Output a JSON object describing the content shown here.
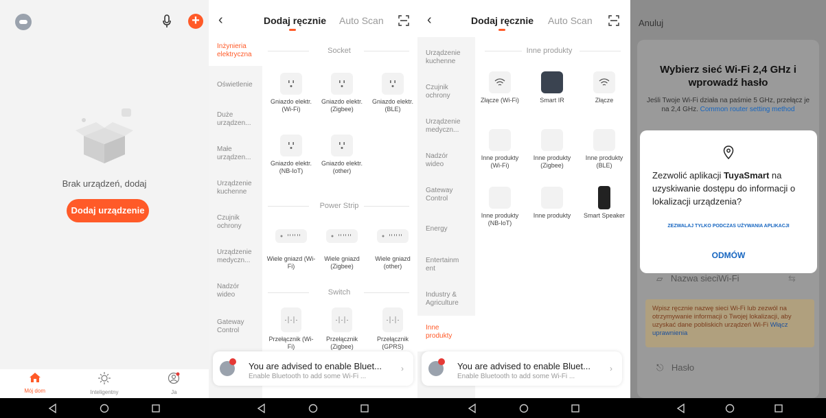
{
  "panel1": {
    "empty_text": "Brak urządzeń, dodaj",
    "add_device_button": "Dodaj urządzenie",
    "tabs": [
      {
        "label": "Mój dom",
        "icon": "home-icon",
        "active": true
      },
      {
        "label": "Inteligentny",
        "icon": "sun-icon",
        "active": false
      },
      {
        "label": "Ja",
        "icon": "profile-icon",
        "active": false
      }
    ],
    "accent": "#ff5a28"
  },
  "panel2": {
    "tab_manual": "Dodaj ręcznie",
    "tab_scan": "Auto Scan",
    "sidebar": [
      "Inżynieria elektryczna",
      "Oświetlenie",
      "Duże urządzen...",
      "Małe urządzen...",
      "Urządzenie kuchenne",
      "Czujnik ochrony",
      "Urządzenie medyczn...",
      "Nadzór wideo",
      "Gateway Control"
    ],
    "sections": [
      {
        "title": "Socket",
        "items": [
          "Gniazdo elektr. (Wi-Fi)",
          "Gniazdo elektr. (Zigbee)",
          "Gniazdo elektr. (BLE)",
          "Gniazdo elektr. (NB-IoT)",
          "Gniazdo elektr. (other)"
        ]
      },
      {
        "title": "Power Strip",
        "items": [
          "Wiele gniazd (Wi-Fi)",
          "Wiele gniazd (Zigbee)",
          "Wiele gniazd (other)"
        ]
      },
      {
        "title": "Switch",
        "items": [
          "Przełącznik (Wi-Fi)",
          "Przełącznik (Zigbee)",
          "Przełącznik (GPRS)"
        ]
      }
    ],
    "banner": {
      "title": "You are advised to enable Bluet...",
      "subtitle": "Enable Bluetooth to add some Wi-Fi ..."
    }
  },
  "panel3": {
    "tab_manual": "Dodaj ręcznie",
    "tab_scan": "Auto Scan",
    "sidebar": [
      "Urządzenie kuchenne",
      "Czujnik ochrony",
      "Urządzenie medyczn...",
      "Nadzór wideo",
      "Gateway Control",
      "Energy",
      "Entertainm ent",
      "Industry & Agriculture",
      "Inne produkty"
    ],
    "section_title": "Inne produkty",
    "items": [
      "Złącze (Wi-Fi)",
      "Smart IR",
      "Złącze",
      "Inne produkty (Wi-Fi)",
      "Inne produkty (Zigbee)",
      "Inne produkty (BLE)",
      "Inne produkty (NB-IoT)",
      "Inne produkty",
      "Smart Speaker"
    ],
    "banner": {
      "title": "You are advised to enable Bluet...",
      "subtitle": "Enable Bluetooth to add some Wi-Fi ..."
    }
  },
  "panel4": {
    "cancel": "Anuluj",
    "title_line1": "Wybierz sieć Wi-Fi 2,4 GHz i",
    "title_line2": "wprowadź hasło",
    "subtitle": "Jeśli Twoje Wi-Fi działa na paśmie 5 GHz, przełącz je na 2,4 GHz.",
    "subtitle_link": "Common router setting method",
    "dialog_msg_pre": "Zezwolić aplikacji ",
    "dialog_app": "TuyaSmart",
    "dialog_msg_post": " na uzyskiwanie dostępu do informacji o lokalizacji urządzenia?",
    "allow_label": "ZEZWALAJ TYLKO PODCZAS UŻYWANIA APLIKACJI",
    "deny_label": "ODMÓW",
    "wifi_placeholder": "Nazwa sieciWi-Fi",
    "warning": "Wpisz ręcznie nazwę sieci Wi-Fi lub zezwól na otrzymywanie informacji o Twojej lokalizacji, aby uzyskać dane pobliskich urządzeń Wi-Fi",
    "warning_link": "Włącz uprawnienia",
    "password_placeholder": "Hasło"
  }
}
